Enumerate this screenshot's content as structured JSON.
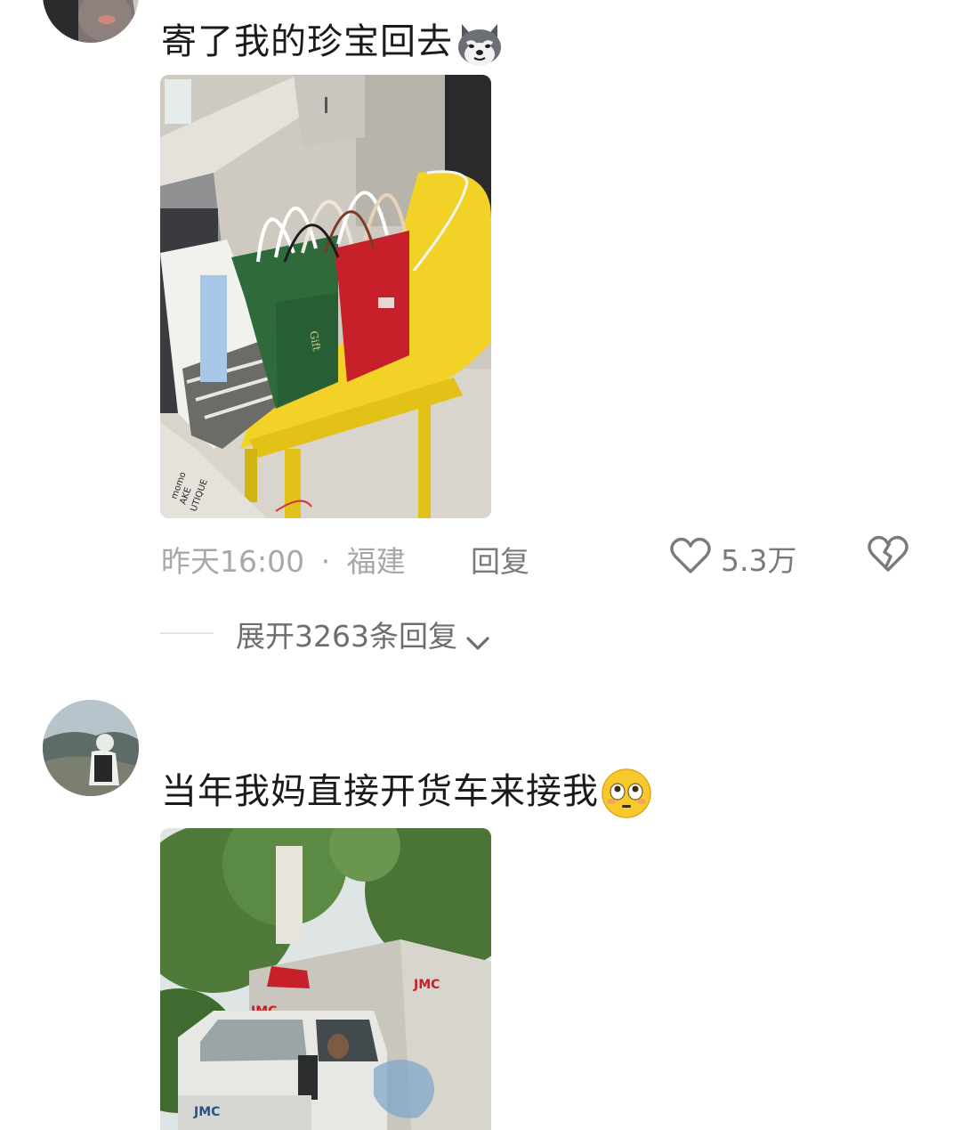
{
  "comments": [
    {
      "text": "寄了我的珍宝回去",
      "emoji_icon": "husky-dog-icon",
      "time": "昨天16:00",
      "separator": "·",
      "location": "福建",
      "reply_label": "回复",
      "like_count": "5.3万",
      "expand_label": "展开3263条回复",
      "photo_subject": "shopping-bags-on-yellow-chair",
      "photo_text": [
        "momo",
        "AKE",
        "UTIQUE"
      ]
    },
    {
      "text": "当年我妈直接开货车来接我",
      "emoji_icon": "flushed-face-icon",
      "photo_subject": "white-jmc-truck-under-trees",
      "photo_text": [
        "JMC",
        "JMC",
        "JMC"
      ]
    }
  ],
  "colors": {
    "text_primary": "#1a1a1a",
    "text_meta": "#a8a8a8",
    "text_secondary": "#7a7a7a",
    "chair_yellow": "#f2d226",
    "bag_green": "#2f6b3a",
    "bag_red": "#c8202a"
  }
}
